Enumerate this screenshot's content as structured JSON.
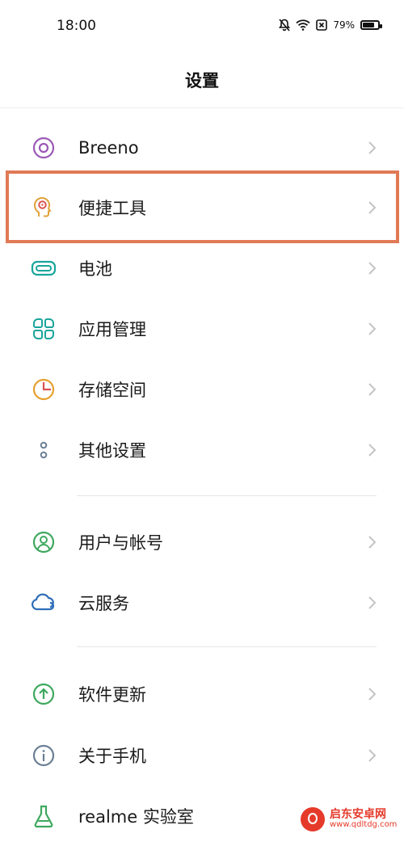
{
  "status_bar": {
    "time": "18:00",
    "battery_percent_label": "79%",
    "battery_level": 0.79,
    "icons": [
      "bell-off-icon",
      "wifi-icon",
      "nfc-icon",
      "battery-icon"
    ]
  },
  "header": {
    "title": "设置"
  },
  "settings": {
    "items": [
      {
        "label": "Breeno",
        "icon": "breeno-icon",
        "color": "#9b59b6"
      },
      {
        "label": "便捷工具",
        "icon": "convenience-tools-icon",
        "color": "#e0a13a",
        "highlighted": true
      },
      {
        "label": "电池",
        "icon": "battery-setting-icon",
        "color": "#1aa59b"
      },
      {
        "label": "应用管理",
        "icon": "app-management-icon",
        "color": "#1aa59b"
      },
      {
        "label": "存储空间",
        "icon": "storage-icon",
        "color": "#e6a02e"
      },
      {
        "label": "其他设置",
        "icon": "other-settings-icon",
        "color": "#6a7f94"
      },
      {
        "label": "用户与帐号",
        "icon": "user-account-icon",
        "color": "#3ea85e"
      },
      {
        "label": "云服务",
        "icon": "cloud-service-icon",
        "color": "#2f6fb8"
      },
      {
        "label": "软件更新",
        "icon": "software-update-icon",
        "color": "#3ea85e"
      },
      {
        "label": "关于手机",
        "icon": "about-phone-icon",
        "color": "#6a7f94"
      },
      {
        "label": "realme 实验室",
        "icon": "realme-lab-icon",
        "color": "#3ea85e"
      }
    ]
  },
  "highlight_color": "#e07a55",
  "watermark": {
    "title": "启东安卓网",
    "url": "www.qdltdg.com"
  }
}
